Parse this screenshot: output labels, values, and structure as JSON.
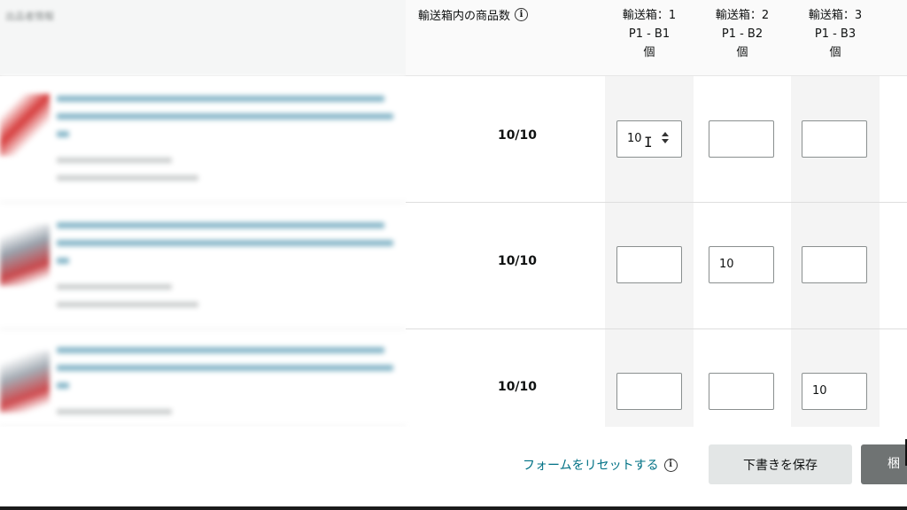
{
  "left_header": {
    "label": "出品者情報"
  },
  "header": {
    "count_label": "輸送箱内の商品数",
    "boxes": [
      {
        "title": "輸送箱：1",
        "id": "P1 - B1",
        "unit": "個"
      },
      {
        "title": "輸送箱：2",
        "id": "P1 - B2",
        "unit": "個"
      },
      {
        "title": "輸送箱：3",
        "id": "P1 - B3",
        "unit": "個"
      }
    ]
  },
  "rows": [
    {
      "count": "10/10",
      "qty": [
        "10",
        "",
        ""
      ]
    },
    {
      "count": "10/10",
      "qty": [
        "",
        "10",
        ""
      ]
    },
    {
      "count": "10/10",
      "qty": [
        "",
        "",
        "10"
      ]
    }
  ],
  "footer": {
    "reset_label": "フォームをリセットする",
    "save_label": "下書きを保存",
    "next_label": "梱"
  },
  "colors": {
    "link": "#007185",
    "primary_button": "#6f7373",
    "secondary_button": "#e3e6e6"
  }
}
